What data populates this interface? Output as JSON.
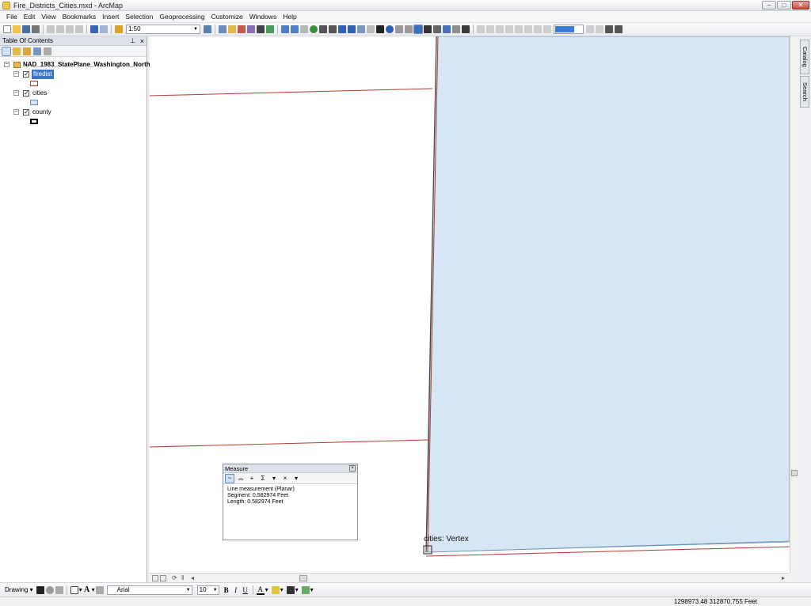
{
  "window": {
    "title": "Fire_Districts_Cities.mxd - ArcMap",
    "minimize": "–",
    "maximize": "□",
    "close": "✕"
  },
  "menu": [
    "File",
    "Edit",
    "View",
    "Bookmarks",
    "Insert",
    "Selection",
    "Geoprocessing",
    "Customize",
    "Windows",
    "Help"
  ],
  "toolbar": {
    "scale": "1:50"
  },
  "toc": {
    "title": "Table Of Contents",
    "dataframe": "NAD_1983_StatePlane_Washington_North",
    "layers": [
      {
        "name": "firedist",
        "visible": true,
        "selected": true,
        "symbol_fill": "#ffffff",
        "symbol_outline": "#b33a2c"
      },
      {
        "name": "cities",
        "visible": true,
        "selected": false,
        "symbol_fill": "#d7e6f4",
        "symbol_outline": "#6a8fb5"
      },
      {
        "name": "county",
        "visible": true,
        "selected": false,
        "symbol_fill": "#ffffff",
        "symbol_outline": "#000000"
      }
    ]
  },
  "map": {
    "snap_label": "cities: Vertex",
    "colors": {
      "cities_fill": "#d7e6f4",
      "firedist_line": "#b33a2c",
      "county_line": "#444444"
    }
  },
  "measure": {
    "title": "Measure",
    "mode": "Line measurement (Planar)",
    "segment": "Segment: 0.582974 Feet",
    "length": "Length: 0.582974 Feet"
  },
  "side_tabs": [
    "Catalog",
    "Search"
  ],
  "drawing": {
    "label": "Drawing",
    "font": "Arial",
    "size": "10"
  },
  "status": {
    "coords": "1298973.48  312870.755 Feet"
  }
}
